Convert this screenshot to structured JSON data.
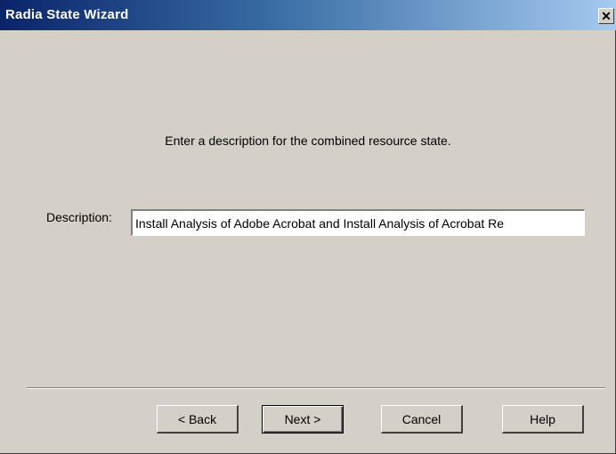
{
  "window": {
    "title": "Radia State Wizard",
    "close_glyph": "✕"
  },
  "main": {
    "instruction": "Enter a description for the combined resource state.",
    "description_label": "Description:",
    "description_value": "Install Analysis of Adobe Acrobat and Install Analysis of Acrobat Re"
  },
  "buttons": {
    "back": "< Back",
    "next": "Next >",
    "cancel": "Cancel",
    "help": "Help"
  },
  "colors": {
    "titlebar_start": "#0a246a",
    "titlebar_end": "#a6caf0",
    "dialog_face": "#d4d0c8"
  }
}
